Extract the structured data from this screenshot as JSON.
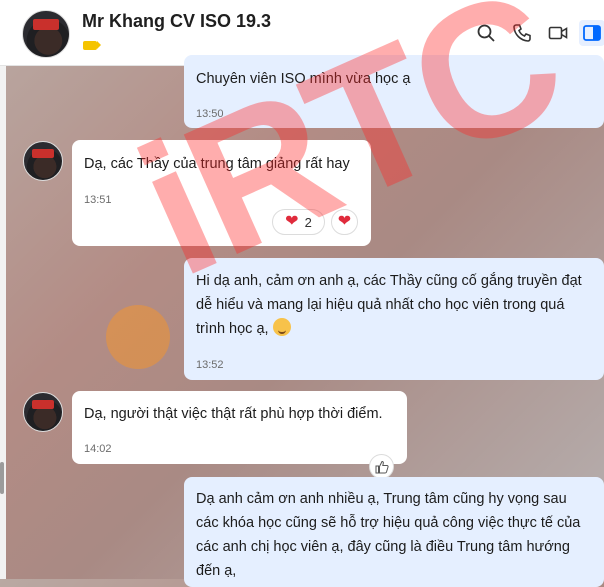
{
  "header": {
    "contact_name": "Mr Khang CV ISO 19.3",
    "icons": [
      "search-icon",
      "phone-icon",
      "video-icon",
      "panel-icon"
    ]
  },
  "messages": [
    {
      "side": "out",
      "text": "Chuyên viên ISO mình vừa học ạ",
      "time": "13:50"
    },
    {
      "side": "in",
      "text": "Dạ, các Thầy của trung tâm giảng rất hay",
      "time": "13:51",
      "reaction_count": "2"
    },
    {
      "side": "out",
      "lines": [
        "Hi dạ anh, cảm ơn anh ạ, các Thầy cũng cố gắng truyền đạt",
        "dễ hiểu và mang lại hiệu quả nhất cho học viên trong quá",
        "trình học  ạ,"
      ],
      "time": "13:52"
    },
    {
      "side": "in",
      "text": "Dạ, người thật việc thật rất phù hợp thời điểm.",
      "time": "14:02"
    },
    {
      "side": "out",
      "lines": [
        "Dạ anh cảm ơn anh nhiều ạ, Trung tâm cũng hy vọng sau",
        "các khóa học cũng sẽ hỗ trợ hiệu quả công việc thực tế của",
        "các anh chị học viên ạ, đây cũng là điều Trung tâm hướng",
        "đến ạ,"
      ]
    }
  ],
  "watermark": "iRTC",
  "colors": {
    "out_bubble": "#e5efff",
    "in_bubble": "#ffffff",
    "heart": "#e02b3c",
    "label": "#f5c400"
  }
}
